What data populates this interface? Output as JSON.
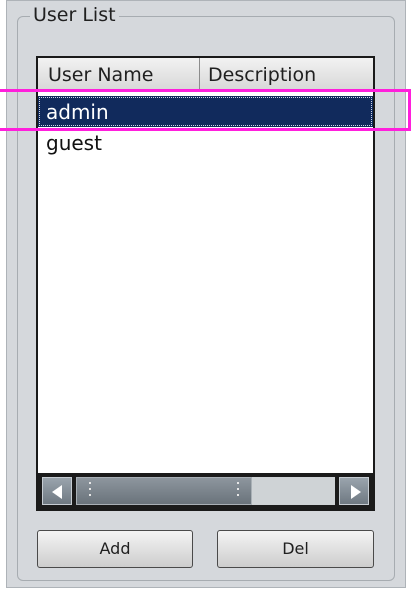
{
  "group": {
    "title": "User List"
  },
  "list": {
    "columns": [
      "User Name",
      "Description"
    ],
    "rows": [
      {
        "user_name": "admin",
        "description": "",
        "selected": true
      },
      {
        "user_name": "guest",
        "description": "",
        "selected": false
      }
    ]
  },
  "scrollbar": {
    "left_icon": "arrow-left-icon",
    "right_icon": "arrow-right-icon",
    "thumb_fraction": 0.68
  },
  "buttons": {
    "add_label": "Add",
    "del_label": "Del"
  },
  "colors": {
    "selection": "#112a5c",
    "highlight": "#ff1fdc",
    "panel": "#d5d8dc"
  }
}
